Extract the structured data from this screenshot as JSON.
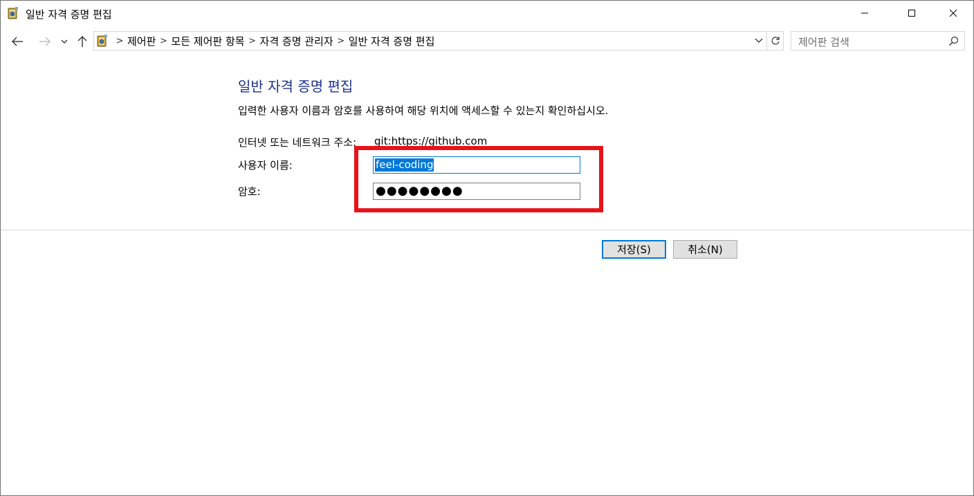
{
  "window": {
    "title": "일반 자격 증명 편집"
  },
  "nav": {
    "breadcrumbs": [
      "제어판",
      "모든 제어판 항목",
      "자격 증명 관리자",
      "일반 자격 증명 편집"
    ],
    "search_placeholder": "제어판 검색"
  },
  "content": {
    "heading": "일반 자격 증명 편집",
    "description": "입력한 사용자 이름과 암호를 사용하여 해당 위치에 액세스할 수 있는지 확인하십시오.",
    "address_label": "인터넷 또는 네트워크 주소:",
    "address_value": "git:https://github.com",
    "username_label": "사용자 이름:",
    "username_value": "feel-coding",
    "password_label": "암호:",
    "password_mask": "●●●●●●●●"
  },
  "buttons": {
    "save_label": "저장(S)",
    "cancel_label": "취소(N)"
  },
  "colors": {
    "heading": "#1e3287",
    "accent": "#0078d7",
    "highlight": "#e8121a"
  }
}
